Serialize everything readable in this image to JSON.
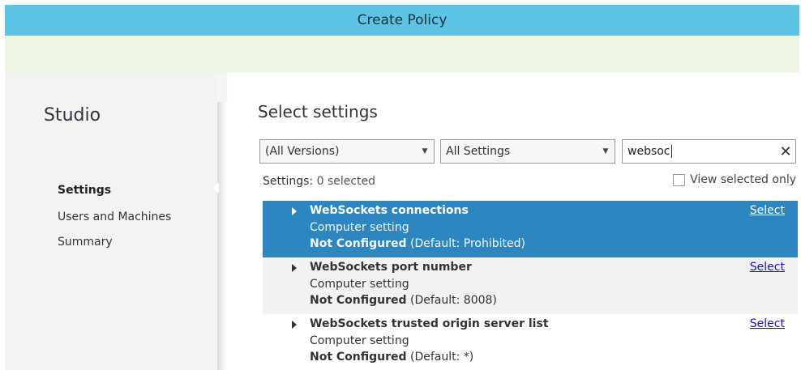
{
  "window": {
    "title": "Create Policy"
  },
  "sidebar": {
    "title": "Studio",
    "items": [
      {
        "label": "Settings",
        "active": true
      },
      {
        "label": "Users and Machines",
        "active": false
      },
      {
        "label": "Summary",
        "active": false
      }
    ]
  },
  "main": {
    "title": "Select settings",
    "filters": {
      "version": {
        "selected": "(All Versions)"
      },
      "category": {
        "selected": "All Settings"
      },
      "search": {
        "value": "websoc",
        "clear_icon": "close-icon"
      }
    },
    "count": {
      "prefix": "Settings:",
      "value": "0 selected"
    },
    "view_selected_only": {
      "label": "View selected only",
      "checked": false
    },
    "settings": [
      {
        "name": "WebSockets connections",
        "scope": "Computer setting",
        "state": "Not Configured",
        "default_text": "(Default: Prohibited)",
        "action": "Select",
        "highlighted": true
      },
      {
        "name": "WebSockets port number",
        "scope": "Computer setting",
        "state": "Not Configured",
        "default_text": "(Default: 8008)",
        "action": "Select",
        "highlighted": false
      },
      {
        "name": "WebSockets trusted origin server list",
        "scope": "Computer setting",
        "state": "Not Configured",
        "default_text": "(Default: *)",
        "action": "Select",
        "highlighted": false
      }
    ]
  },
  "colors": {
    "titlebar": "#5dc4e6",
    "selected_row": "#2e86c1",
    "link": "#1a0fcc"
  }
}
